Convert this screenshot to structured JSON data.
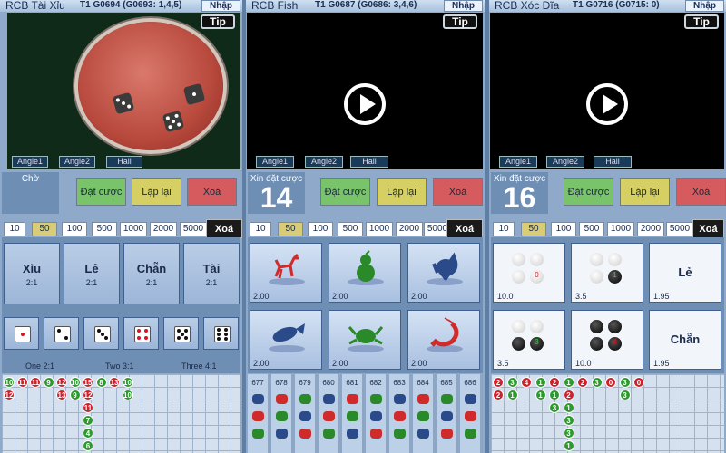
{
  "panels": [
    {
      "title": "RCB Tài Xỉu",
      "round": "T1 G0694 (G0693: 1,4,5)",
      "nhap_label": "Nhập",
      "tip_label": "Tip",
      "cameras": [
        "Angle1",
        "Angle2",
        "Hall"
      ],
      "status_label": "Chờ",
      "buttons": {
        "bet": "Đặt cược",
        "repeat": "Lặp lại",
        "clear": "Xoá"
      },
      "chips": [
        "10",
        "50",
        "100",
        "500",
        "1000",
        "2000",
        "5000"
      ],
      "selected_chip": "50",
      "chip_clear": "Xoá",
      "bet_cells": [
        {
          "name": "Xỉu",
          "ratio": "2:1"
        },
        {
          "name": "Lẻ",
          "ratio": "2:1"
        },
        {
          "name": "Chẵn",
          "ratio": "2:1"
        },
        {
          "name": "Tài",
          "ratio": "2:1"
        }
      ],
      "dice_faces": [
        1,
        2,
        3,
        4,
        5,
        6
      ],
      "dice_labels": [
        "One 2:1",
        "Two 3:1",
        "Three 4:1"
      ],
      "history": {
        "columns": [
          [
            "10",
            "12"
          ],
          [
            "11"
          ],
          [
            "11"
          ],
          [
            "9"
          ],
          [
            "12",
            "13"
          ],
          [
            "10",
            "9"
          ],
          [
            "15",
            "12",
            "11",
            "7",
            "4",
            "6"
          ],
          [
            "8"
          ],
          [
            "13"
          ],
          [
            "10",
            "10"
          ]
        ]
      }
    },
    {
      "title": "RCB Fish",
      "round": "T1 G0687 (G0686: 3,4,6)",
      "nhap_label": "Nhập",
      "tip_label": "Tip",
      "cameras": [
        "Angle1",
        "Angle2",
        "Hall"
      ],
      "status_label": "Xin đặt cược",
      "countdown": "14",
      "buttons": {
        "bet": "Đặt cược",
        "repeat": "Lặp lại",
        "clear": "Xoá"
      },
      "chips": [
        "10",
        "50",
        "100",
        "500",
        "1000",
        "2000",
        "5000"
      ],
      "selected_chip": "50",
      "chip_clear": "Xoá",
      "bet_cells": [
        {
          "icon": "deer-icon",
          "odds": "2.00",
          "color": "#d02b2b"
        },
        {
          "icon": "gourd-icon",
          "odds": "2.00",
          "color": "#2a8a2a"
        },
        {
          "icon": "rooster-icon",
          "odds": "2.00",
          "color": "#2a4a8a"
        },
        {
          "icon": "fish-icon",
          "odds": "2.00",
          "color": "#2a4a8a"
        },
        {
          "icon": "crab-icon",
          "odds": "2.00",
          "color": "#2a8a2a"
        },
        {
          "icon": "shrimp-icon",
          "odds": "2.00",
          "color": "#d02b2b"
        }
      ],
      "history_rounds": [
        "677",
        "678",
        "679",
        "680",
        "681",
        "682",
        "683",
        "684",
        "685",
        "686"
      ]
    },
    {
      "title": "RCB Xóc Đĩa",
      "round": "T1 G0716 (G0715: 0)",
      "nhap_label": "Nhập",
      "tip_label": "Tip",
      "cameras": [
        "Angle1",
        "Angle2",
        "Hall"
      ],
      "status_label": "Xin đặt cược",
      "countdown": "16",
      "buttons": {
        "bet": "Đặt cược",
        "repeat": "Lặp lại",
        "clear": "Xoá"
      },
      "chips": [
        "10",
        "50",
        "100",
        "500",
        "1000",
        "2000",
        "5000"
      ],
      "selected_chip": "50",
      "chip_clear": "Xoá",
      "bet_cells": [
        {
          "kind": "discs",
          "pattern": "4-white",
          "marker": "0",
          "odds": "10.0"
        },
        {
          "kind": "discs",
          "pattern": "3-white-1-black",
          "marker": "1",
          "odds": "3.5"
        },
        {
          "kind": "text",
          "label": "Lẻ",
          "odds": "1.95"
        },
        {
          "kind": "discs",
          "pattern": "2-white-2-black",
          "marker": "3",
          "odds": "3.5"
        },
        {
          "kind": "discs",
          "pattern": "4-black",
          "marker": "4",
          "odds": "10.0"
        },
        {
          "kind": "text",
          "label": "Chẵn",
          "odds": "1.95"
        }
      ],
      "history": {
        "columns": [
          [
            "2",
            "2"
          ],
          [
            "3",
            "1"
          ],
          [
            "4"
          ],
          [
            "1",
            "1"
          ],
          [
            "2",
            "1",
            "3"
          ],
          [
            "1",
            "2",
            "1",
            "3",
            "3",
            "1"
          ],
          [
            "2"
          ],
          [
            "3"
          ],
          [
            "0"
          ],
          [
            "3",
            "3"
          ],
          [
            "0"
          ]
        ]
      }
    }
  ]
}
